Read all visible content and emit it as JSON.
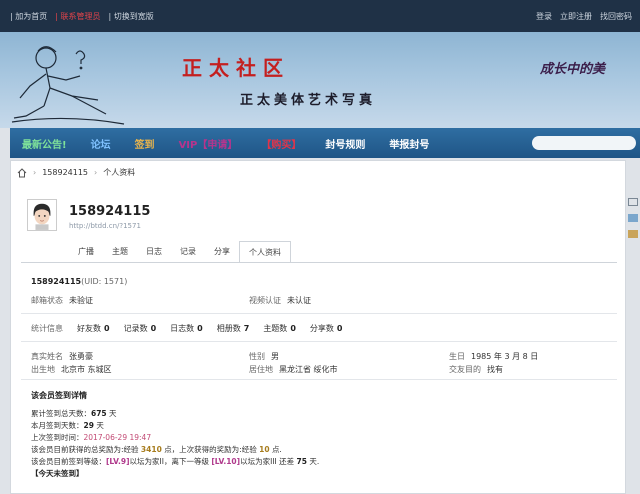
{
  "topbar": {
    "left": [
      "| 加为首页",
      "| 联系管理员",
      "| 切换到宽版"
    ],
    "right": [
      "登录",
      "立即注册",
      "找回密码"
    ],
    "colors": {
      "bg": "#1f3146",
      "accent": "#e2444a"
    }
  },
  "banner": {
    "title": "正太社区",
    "subtitle": "正太美体艺术写真",
    "slogan": "成长中的美"
  },
  "nav": {
    "items": [
      {
        "label": "最新公告!",
        "color": "green"
      },
      {
        "label": "论坛",
        "color": "blue"
      },
      {
        "label": "签到",
        "color": "orange"
      },
      {
        "label": "VIP【申请】",
        "color": "purple"
      },
      {
        "label": "【购买】",
        "color": "red"
      },
      {
        "label": "封号规则",
        "color": "white"
      },
      {
        "label": "举报封号",
        "color": "white"
      }
    ]
  },
  "breadcrumb": {
    "user": "158924115",
    "page": "个人资料"
  },
  "profile": {
    "name": "158924115",
    "link": "http://btdd.cn/?1571",
    "tabs": [
      "广播",
      "主题",
      "日志",
      "记录",
      "分享",
      "个人资料"
    ],
    "active_tab": "个人资料",
    "header_name": "158924115",
    "uid_text": "(UID: 1571)",
    "email_status_label": "邮箱状态",
    "email_status_value": "未验证",
    "video_auth_label": "视频认证",
    "video_auth_value": "未认证",
    "stats_label": "统计信息",
    "stats": [
      {
        "label": "好友数",
        "value": "0"
      },
      {
        "label": "记录数",
        "value": "0"
      },
      {
        "label": "日志数",
        "value": "0"
      },
      {
        "label": "相册数",
        "value": "7"
      },
      {
        "label": "主题数",
        "value": "0"
      },
      {
        "label": "分享数",
        "value": "0"
      }
    ],
    "real_name_label": "真实姓名",
    "real_name_value": "张勇豪",
    "gender_label": "性别",
    "gender_value": "男",
    "birthday_label": "生日",
    "birthday_value": "1985 年 3 月 8 日",
    "birthplace_label": "出生地",
    "birthplace_value": "北京市 东城区",
    "residence_label": "居住地",
    "residence_value": "黑龙江省 绥化市",
    "purpose_label": "交友目的",
    "purpose_value": "找有"
  },
  "signin": {
    "title": "该会员签到详情",
    "total_days_label": "累计签到总天数：",
    "total_days_value": "675",
    "total_days_unit": "天",
    "month_days_label": "本月签到天数：",
    "month_days_value": "29",
    "month_days_unit": "天",
    "last_time_label": "上次签到时间：",
    "last_time_value": "2017-06-29 19:47",
    "reward_prefix": "该会员目前获得的总奖励为:经验",
    "reward_value": "3410",
    "reward_mid": "点，上次获得的奖励为:经验",
    "last_reward_value": "10",
    "reward_suffix": "点.",
    "level_prefix": "该会员目前签到等级：",
    "level_current": "[LV.9]",
    "level_current_name": "以坛为家II",
    "level_mid": "，离下一等级",
    "level_next": "[LV.10]",
    "level_next_name": "以坛为家III",
    "level_suffix_pre": "还差",
    "level_remaining": "75",
    "level_suffix": "天.",
    "today_link": "【今天未签到】"
  }
}
